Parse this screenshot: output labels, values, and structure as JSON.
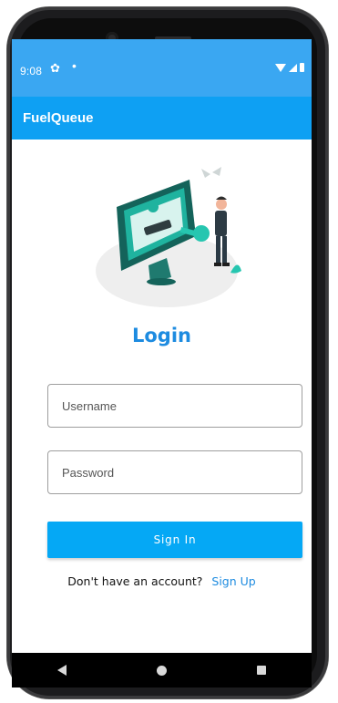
{
  "status": {
    "time": "9:08",
    "gear_icon": "gear-icon",
    "dot_icon": "notification-dot-icon"
  },
  "appbar": {
    "title": "FuelQueue"
  },
  "login": {
    "title": "Login",
    "username_placeholder": "Username",
    "password_placeholder": "Password",
    "signin_label": "Sign In",
    "signup_prompt": "Don't have an account?",
    "signup_link": "Sign Up"
  },
  "colors": {
    "status_bar": "#3aa7f2",
    "app_bar": "#0ea0f3",
    "accent": "#1d8be0",
    "button": "#05a8f5"
  },
  "nav": {
    "back_icon": "back-icon",
    "home_icon": "home-icon",
    "recents_icon": "recents-icon"
  }
}
